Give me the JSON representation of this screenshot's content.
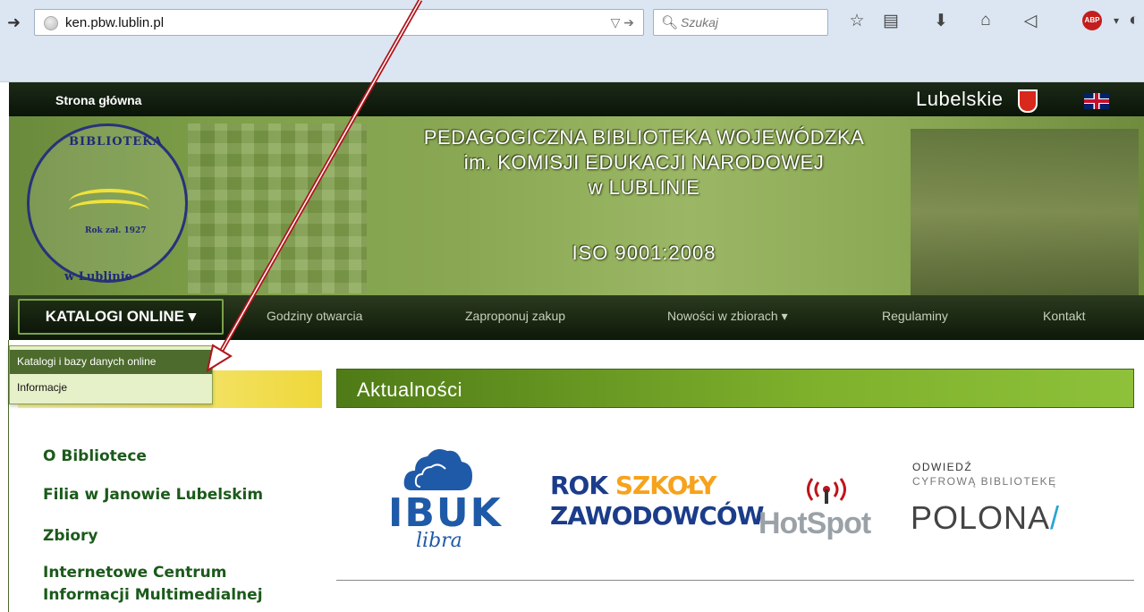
{
  "browser": {
    "url": "ken.pbw.lublin.pl",
    "search_placeholder": "Szukaj",
    "abp_label": "ABP"
  },
  "site": {
    "home_link": "Strona główna",
    "region_label": "Lubelskie",
    "seal": {
      "top_text": "BIBLIOTEKA",
      "year_text": "Rok zał. 1927",
      "city_text": "w Lublinie"
    },
    "institution_lines": [
      "PEDAGOGICZNA  BIBLIOTEKA  WOJEWÓDZKA",
      "im.  KOMISJI  EDUKACJI  NARODOWEJ",
      "w  LUBLINIE"
    ],
    "iso": "ISO  9001:2008"
  },
  "mainnav": {
    "active": "KATALOGI ONLINE ▾",
    "items": [
      "Godziny otwarcia",
      "Zaproponuj zakup",
      "Nowości w zbiorach ▾",
      "Regulaminy",
      "Kontakt"
    ]
  },
  "dropdown": {
    "items": [
      "Katalogi i bazy danych online",
      "Informacje"
    ]
  },
  "sidebar": {
    "links": [
      "O Bibliotece",
      "Filia w Janowie Lubelskim",
      "Zbiory",
      "Internetowe Centrum",
      "Informacji Multimedialnej"
    ]
  },
  "content": {
    "section_title": "Aktualności",
    "logos": {
      "ibuk": "IBUK",
      "ibuk_sub": "libra",
      "rok_line1_a": "ROK ",
      "rok_line1_b": "SZKOŁY",
      "rok_line2": "ZAWODOWCÓW",
      "hotspot": "HotSpot",
      "polona_small_1": "ODWIEDŹ",
      "polona_small_2": "CYFROWĄ BIBLIOTEKĘ",
      "polona_big": "POLONA",
      "polona_slash": "/"
    }
  },
  "colors": {
    "nav_dark": "#0f1a0a",
    "accent_green": "#7fb12c",
    "link_green": "#1b5a1b",
    "annotation_red": "#b0151c"
  }
}
